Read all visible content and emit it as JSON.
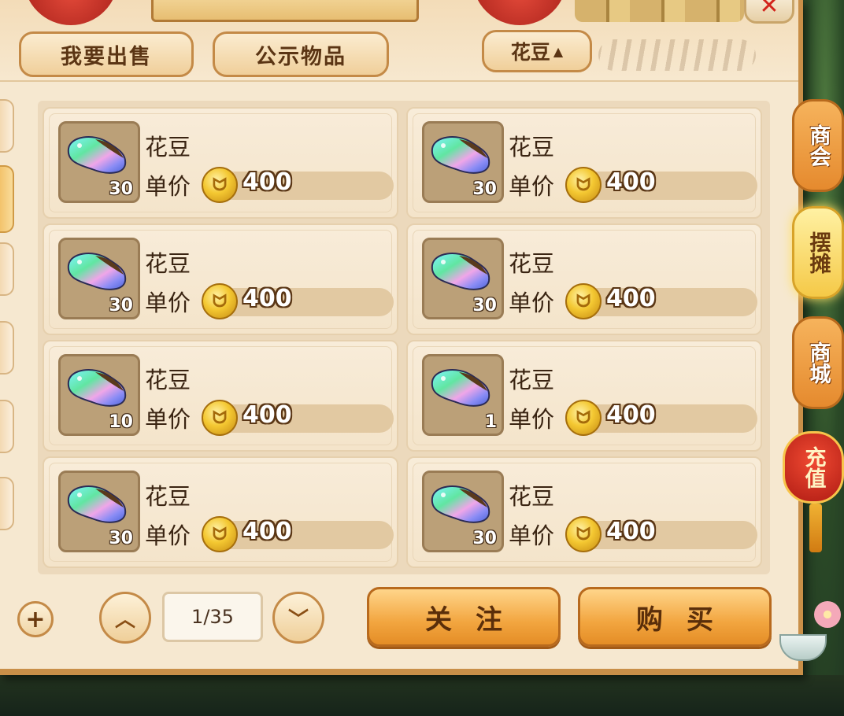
{
  "header": {
    "tabs": [
      {
        "label": "我要出售"
      },
      {
        "label": "公示物品"
      }
    ],
    "filter": {
      "label": "花豆",
      "arrow": "▲"
    },
    "close_label": "✕"
  },
  "listings": [
    {
      "name": "花豆",
      "price_label": "单价",
      "price": "400",
      "quantity": "30",
      "icon": "rainbow-bean-icon"
    },
    {
      "name": "花豆",
      "price_label": "单价",
      "price": "400",
      "quantity": "30",
      "icon": "rainbow-bean-icon"
    },
    {
      "name": "花豆",
      "price_label": "单价",
      "price": "400",
      "quantity": "30",
      "icon": "rainbow-bean-icon"
    },
    {
      "name": "花豆",
      "price_label": "单价",
      "price": "400",
      "quantity": "30",
      "icon": "rainbow-bean-icon"
    },
    {
      "name": "花豆",
      "price_label": "单价",
      "price": "400",
      "quantity": "10",
      "icon": "rainbow-bean-icon"
    },
    {
      "name": "花豆",
      "price_label": "单价",
      "price": "400",
      "quantity": "1",
      "icon": "rainbow-bean-icon"
    },
    {
      "name": "花豆",
      "price_label": "单价",
      "price": "400",
      "quantity": "30",
      "icon": "rainbow-bean-icon"
    },
    {
      "name": "花豆",
      "price_label": "单价",
      "price": "400",
      "quantity": "30",
      "icon": "rainbow-bean-icon"
    }
  ],
  "pagination": {
    "current": "1/35"
  },
  "actions": {
    "follow": "关注",
    "buy": "购买"
  },
  "side_menu": [
    {
      "label": "商会",
      "active": false
    },
    {
      "label": "摆摊",
      "active": true
    },
    {
      "label": "商城",
      "active": false
    },
    {
      "label": "充值",
      "active": false
    }
  ],
  "colors": {
    "panel_bg": "#f6e8d0",
    "border": "#c48a47",
    "button_orange": "#f2a53f",
    "side_active": "#f5c947",
    "price_text": "#ffffff"
  }
}
